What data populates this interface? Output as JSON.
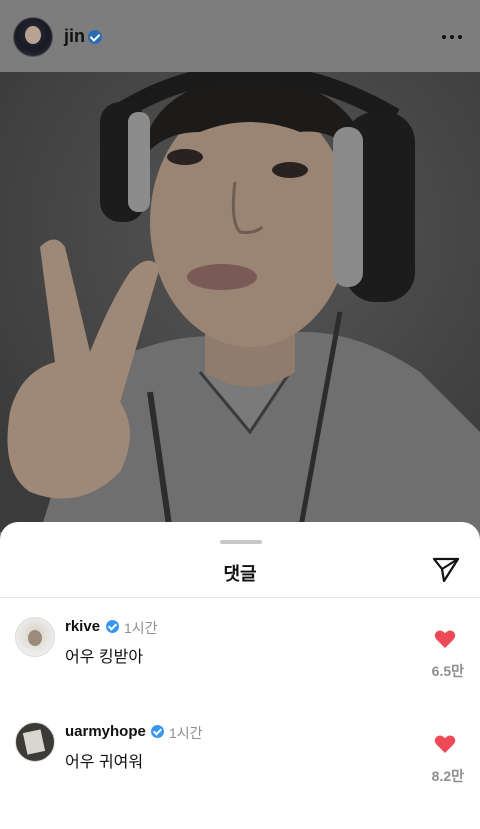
{
  "post": {
    "username": "jin",
    "icons": {
      "verified": "verified-badge-icon",
      "more": "more-options-icon"
    }
  },
  "sheet": {
    "title": "댓글",
    "icons": {
      "share": "paper-plane-icon"
    }
  },
  "comments": [
    {
      "username": "rkive",
      "verified": true,
      "time": "1시간",
      "text": "어우 킹받아",
      "likes": "6.5만",
      "liked": true
    },
    {
      "username": "uarmyhope",
      "verified": true,
      "time": "1시간",
      "text": "어우 귀여워",
      "likes": "8.2만",
      "liked": true
    }
  ],
  "colors": {
    "verified": "#3897f0",
    "heart": "#ed4956",
    "secondary_text": "#8e8e8e"
  }
}
